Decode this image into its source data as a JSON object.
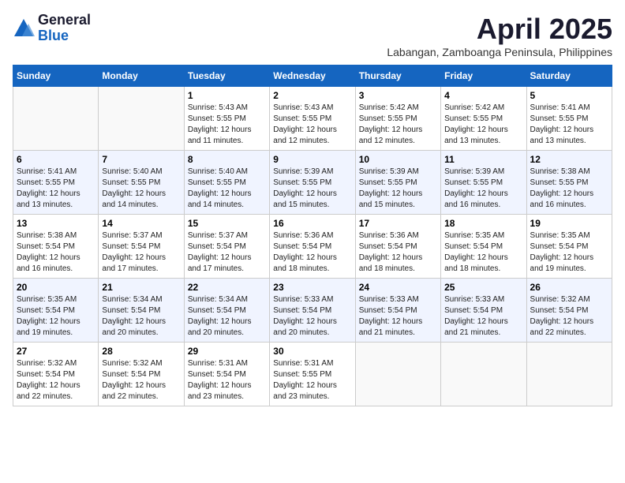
{
  "logo": {
    "general": "General",
    "blue": "Blue"
  },
  "title": "April 2025",
  "subtitle": "Labangan, Zamboanga Peninsula, Philippines",
  "days_of_week": [
    "Sunday",
    "Monday",
    "Tuesday",
    "Wednesday",
    "Thursday",
    "Friday",
    "Saturday"
  ],
  "weeks": [
    [
      {
        "day": "",
        "info": ""
      },
      {
        "day": "",
        "info": ""
      },
      {
        "day": "1",
        "sunrise": "5:43 AM",
        "sunset": "5:55 PM",
        "daylight": "12 hours and 11 minutes."
      },
      {
        "day": "2",
        "sunrise": "5:43 AM",
        "sunset": "5:55 PM",
        "daylight": "12 hours and 12 minutes."
      },
      {
        "day": "3",
        "sunrise": "5:42 AM",
        "sunset": "5:55 PM",
        "daylight": "12 hours and 12 minutes."
      },
      {
        "day": "4",
        "sunrise": "5:42 AM",
        "sunset": "5:55 PM",
        "daylight": "12 hours and 13 minutes."
      },
      {
        "day": "5",
        "sunrise": "5:41 AM",
        "sunset": "5:55 PM",
        "daylight": "12 hours and 13 minutes."
      }
    ],
    [
      {
        "day": "6",
        "sunrise": "5:41 AM",
        "sunset": "5:55 PM",
        "daylight": "12 hours and 13 minutes."
      },
      {
        "day": "7",
        "sunrise": "5:40 AM",
        "sunset": "5:55 PM",
        "daylight": "12 hours and 14 minutes."
      },
      {
        "day": "8",
        "sunrise": "5:40 AM",
        "sunset": "5:55 PM",
        "daylight": "12 hours and 14 minutes."
      },
      {
        "day": "9",
        "sunrise": "5:39 AM",
        "sunset": "5:55 PM",
        "daylight": "12 hours and 15 minutes."
      },
      {
        "day": "10",
        "sunrise": "5:39 AM",
        "sunset": "5:55 PM",
        "daylight": "12 hours and 15 minutes."
      },
      {
        "day": "11",
        "sunrise": "5:39 AM",
        "sunset": "5:55 PM",
        "daylight": "12 hours and 16 minutes."
      },
      {
        "day": "12",
        "sunrise": "5:38 AM",
        "sunset": "5:55 PM",
        "daylight": "12 hours and 16 minutes."
      }
    ],
    [
      {
        "day": "13",
        "sunrise": "5:38 AM",
        "sunset": "5:54 PM",
        "daylight": "12 hours and 16 minutes."
      },
      {
        "day": "14",
        "sunrise": "5:37 AM",
        "sunset": "5:54 PM",
        "daylight": "12 hours and 17 minutes."
      },
      {
        "day": "15",
        "sunrise": "5:37 AM",
        "sunset": "5:54 PM",
        "daylight": "12 hours and 17 minutes."
      },
      {
        "day": "16",
        "sunrise": "5:36 AM",
        "sunset": "5:54 PM",
        "daylight": "12 hours and 18 minutes."
      },
      {
        "day": "17",
        "sunrise": "5:36 AM",
        "sunset": "5:54 PM",
        "daylight": "12 hours and 18 minutes."
      },
      {
        "day": "18",
        "sunrise": "5:35 AM",
        "sunset": "5:54 PM",
        "daylight": "12 hours and 18 minutes."
      },
      {
        "day": "19",
        "sunrise": "5:35 AM",
        "sunset": "5:54 PM",
        "daylight": "12 hours and 19 minutes."
      }
    ],
    [
      {
        "day": "20",
        "sunrise": "5:35 AM",
        "sunset": "5:54 PM",
        "daylight": "12 hours and 19 minutes."
      },
      {
        "day": "21",
        "sunrise": "5:34 AM",
        "sunset": "5:54 PM",
        "daylight": "12 hours and 20 minutes."
      },
      {
        "day": "22",
        "sunrise": "5:34 AM",
        "sunset": "5:54 PM",
        "daylight": "12 hours and 20 minutes."
      },
      {
        "day": "23",
        "sunrise": "5:33 AM",
        "sunset": "5:54 PM",
        "daylight": "12 hours and 20 minutes."
      },
      {
        "day": "24",
        "sunrise": "5:33 AM",
        "sunset": "5:54 PM",
        "daylight": "12 hours and 21 minutes."
      },
      {
        "day": "25",
        "sunrise": "5:33 AM",
        "sunset": "5:54 PM",
        "daylight": "12 hours and 21 minutes."
      },
      {
        "day": "26",
        "sunrise": "5:32 AM",
        "sunset": "5:54 PM",
        "daylight": "12 hours and 22 minutes."
      }
    ],
    [
      {
        "day": "27",
        "sunrise": "5:32 AM",
        "sunset": "5:54 PM",
        "daylight": "12 hours and 22 minutes."
      },
      {
        "day": "28",
        "sunrise": "5:32 AM",
        "sunset": "5:54 PM",
        "daylight": "12 hours and 22 minutes."
      },
      {
        "day": "29",
        "sunrise": "5:31 AM",
        "sunset": "5:54 PM",
        "daylight": "12 hours and 23 minutes."
      },
      {
        "day": "30",
        "sunrise": "5:31 AM",
        "sunset": "5:55 PM",
        "daylight": "12 hours and 23 minutes."
      },
      {
        "day": "",
        "info": ""
      },
      {
        "day": "",
        "info": ""
      },
      {
        "day": "",
        "info": ""
      }
    ]
  ],
  "labels": {
    "sunrise_prefix": "Sunrise: ",
    "sunset_prefix": "Sunset: ",
    "daylight_prefix": "Daylight: 12 hours"
  },
  "colors": {
    "header_bg": "#1565c0",
    "header_text": "#ffffff",
    "logo_dark": "#1a1a2e",
    "logo_blue": "#1565c0"
  }
}
